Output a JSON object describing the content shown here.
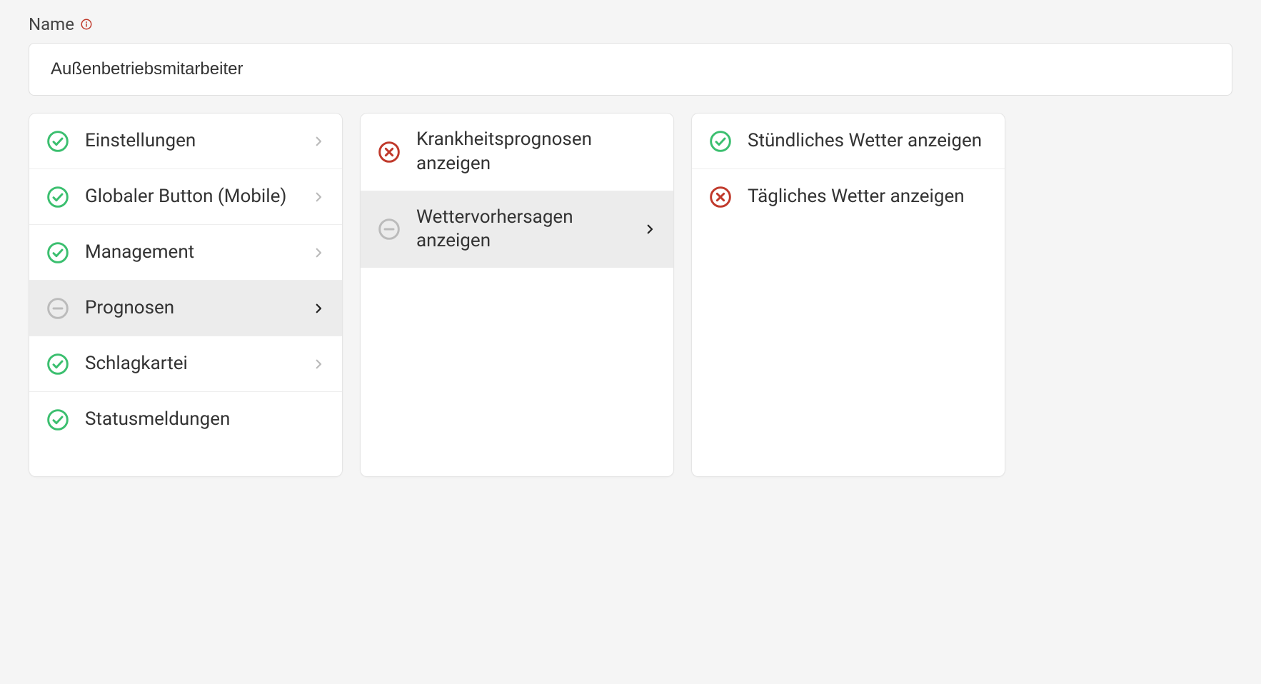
{
  "form": {
    "name_label": "Name",
    "name_value": "Außenbetriebsmitarbeiter"
  },
  "columns": [
    {
      "items": [
        {
          "status": "check",
          "label": "Einstellungen",
          "hasChevron": true,
          "selected": false
        },
        {
          "status": "check",
          "label": "Globaler Button (Mobile)",
          "hasChevron": true,
          "selected": false
        },
        {
          "status": "check",
          "label": "Management",
          "hasChevron": true,
          "selected": false
        },
        {
          "status": "partial",
          "label": "Prognosen",
          "hasChevron": true,
          "selected": true
        },
        {
          "status": "check",
          "label": "Schlagkartei",
          "hasChevron": true,
          "selected": false
        },
        {
          "status": "check",
          "label": "Statusmeldungen",
          "hasChevron": false,
          "selected": false
        }
      ]
    },
    {
      "items": [
        {
          "status": "cross",
          "label": "Krankheitsprognosen anzeigen",
          "hasChevron": false,
          "selected": false
        },
        {
          "status": "partial",
          "label": "Wettervorhersagen anzeigen",
          "hasChevron": true,
          "selected": true
        }
      ]
    },
    {
      "items": [
        {
          "status": "check",
          "label": "Stündliches Wetter anzeigen",
          "hasChevron": false,
          "selected": false
        },
        {
          "status": "cross",
          "label": "Tägliches Wetter anzeigen",
          "hasChevron": false,
          "selected": false
        }
      ]
    }
  ]
}
